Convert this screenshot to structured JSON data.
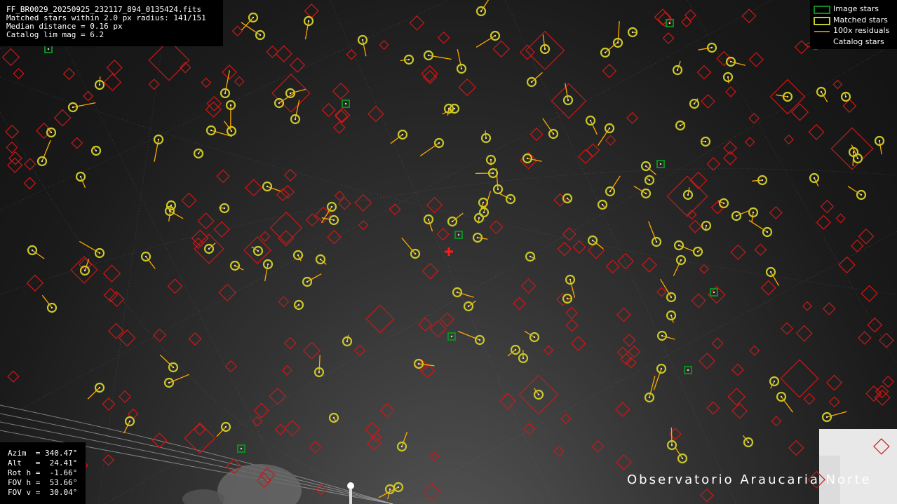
{
  "info": {
    "filename": "FF_BR0029_20250925_232117_894_0135424.fits",
    "matched": "Matched stars within 2.0 px radius: 141/151",
    "median": "Median distance = 0.16 px",
    "catalog": "Catalog lim mag = 6.2"
  },
  "legend": {
    "image_stars": "Image stars",
    "matched_stars": "Matched stars",
    "residuals": "100x residuals",
    "catalog_stars": "Catalog stars"
  },
  "pointing": {
    "azim": "Azim  = 340.47°",
    "alt": "Alt   =  24.41°",
    "rot": "Rot h =  -1.66°",
    "fov_h": "FOV h =  53.66°",
    "fov_v": "FOV v =  30.04°"
  },
  "station": "Observatorio Araucaria Norte",
  "colors": {
    "image_star": "#0f8a22",
    "matched_star": "#c8c828",
    "residual": "#ffaa00",
    "catalog_star": "#cc1818",
    "center_marker": "#ff1a1a"
  }
}
